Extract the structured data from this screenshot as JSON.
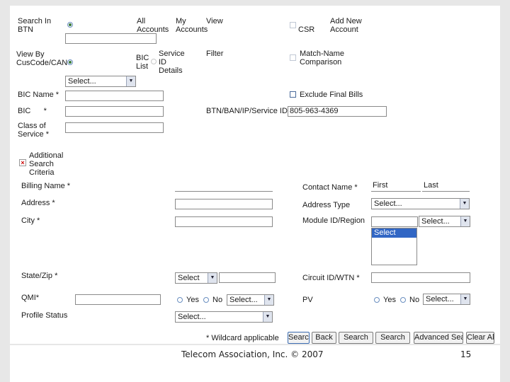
{
  "top": {
    "search_in": "Search In BTN",
    "all_accounts": "All Accounts",
    "my_accounts": "My Accounts",
    "view": "View",
    "csr": "CSR",
    "add_new_account": "Add New Account",
    "view_by": "View By CusCode/CAN",
    "bic_list": "BIC List",
    "service_id_details": "Service ID Details",
    "filter": "Filter",
    "match_name": "Match-Name Comparison",
    "select_placeholder": "Select...",
    "bic_name": "BIC Name *",
    "exclude_final_bills": "Exclude Final Bills",
    "bic": "BIC      *",
    "btn_ban": "BTN/BAN/IP/Service ID *",
    "btn_ban_value": "805-963-4369",
    "class_of_service": "Class of Service *"
  },
  "additional": {
    "title": "Additional Search Criteria",
    "billing_name": "Billing Name *",
    "contact_name": "Contact Name *",
    "first": "First",
    "last": "Last",
    "address": "Address *",
    "address_type": "Address Type",
    "address_type_value": "Select...",
    "city": "City *",
    "module_region": "Module ID/Region",
    "module_region_value": "Select...",
    "list_selected": "Select",
    "state_zip": "State/Zip *",
    "state_value": "Select",
    "circuit": "Circuit ID/WTN *",
    "qmi": "QMI*",
    "yes": "Yes",
    "no": "No",
    "qmi_select": "Select...",
    "pv": "PV",
    "pv_select": "Select...",
    "profile_status": "Profile Status",
    "profile_value": "Select..."
  },
  "actions": {
    "wildcard": "* Wildcard applicable",
    "search1": "Search",
    "back": "Back",
    "search2": "Search",
    "search3": "Search",
    "advanced": "Advanced Search",
    "clear": "Clear All"
  },
  "footer": {
    "copyright": "Telecom Association, Inc. © 2007",
    "page": "15"
  }
}
